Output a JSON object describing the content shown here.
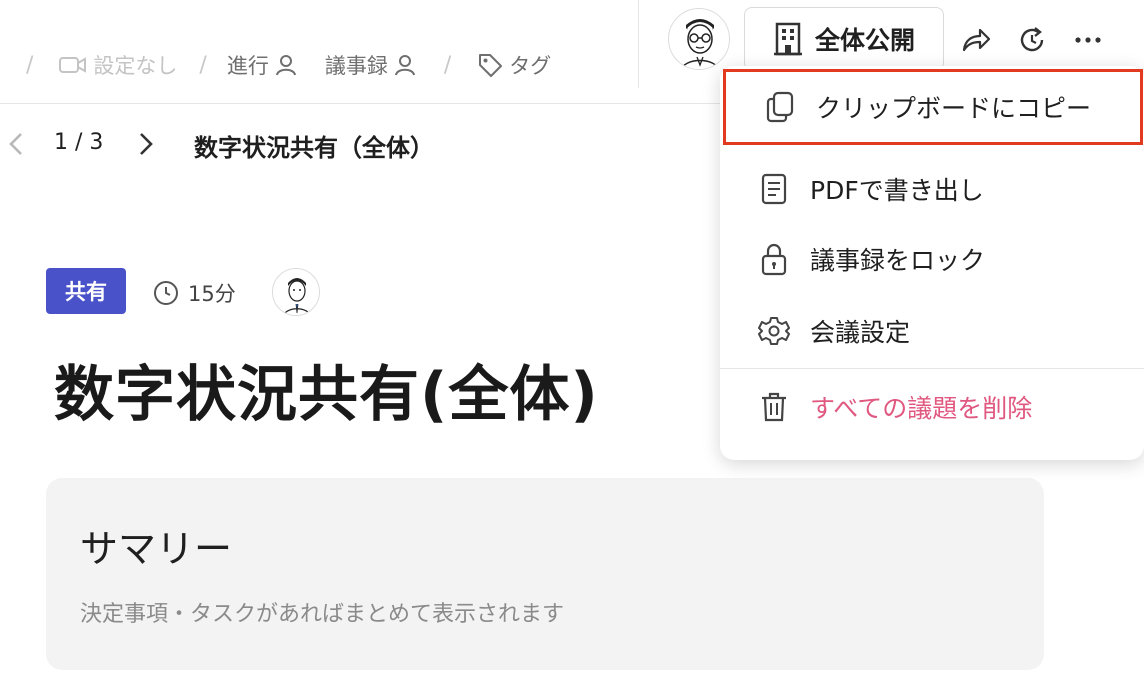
{
  "toolbar": {
    "meta": [
      {
        "label": "設定なし",
        "icon": "video-icon",
        "muted": true
      },
      {
        "label": "進行",
        "icon": "person-icon",
        "muted": false
      },
      {
        "label": "議事録",
        "icon": "person-icon",
        "muted": false
      },
      {
        "label": "タグ",
        "icon": "tag-icon",
        "muted": false
      }
    ],
    "visibility_label": "全体公開",
    "icons": [
      "share-icon",
      "history-icon",
      "more-icon"
    ]
  },
  "nav": {
    "count": "1 / 3",
    "title": "数字状況共有（全体）"
  },
  "agenda": {
    "tag": "共有",
    "duration": "15分",
    "title": "数字状況共有(全体)"
  },
  "summary": {
    "heading": "サマリー",
    "placeholder": "決定事項・タスクがあればまとめて表示されます"
  },
  "menu": {
    "items": [
      {
        "label": "クリップボードにコピー",
        "icon": "copy-icon"
      },
      {
        "label": "PDFで書き出し",
        "icon": "document-icon"
      },
      {
        "label": "議事録をロック",
        "icon": "lock-icon"
      },
      {
        "label": "会議設定",
        "icon": "gear-icon"
      },
      {
        "label": "すべての議題を削除",
        "icon": "trash-icon"
      }
    ]
  },
  "colors": {
    "tag_bg": "#4a52c9",
    "danger": "#e0577f",
    "highlight": "#e23a1e"
  }
}
